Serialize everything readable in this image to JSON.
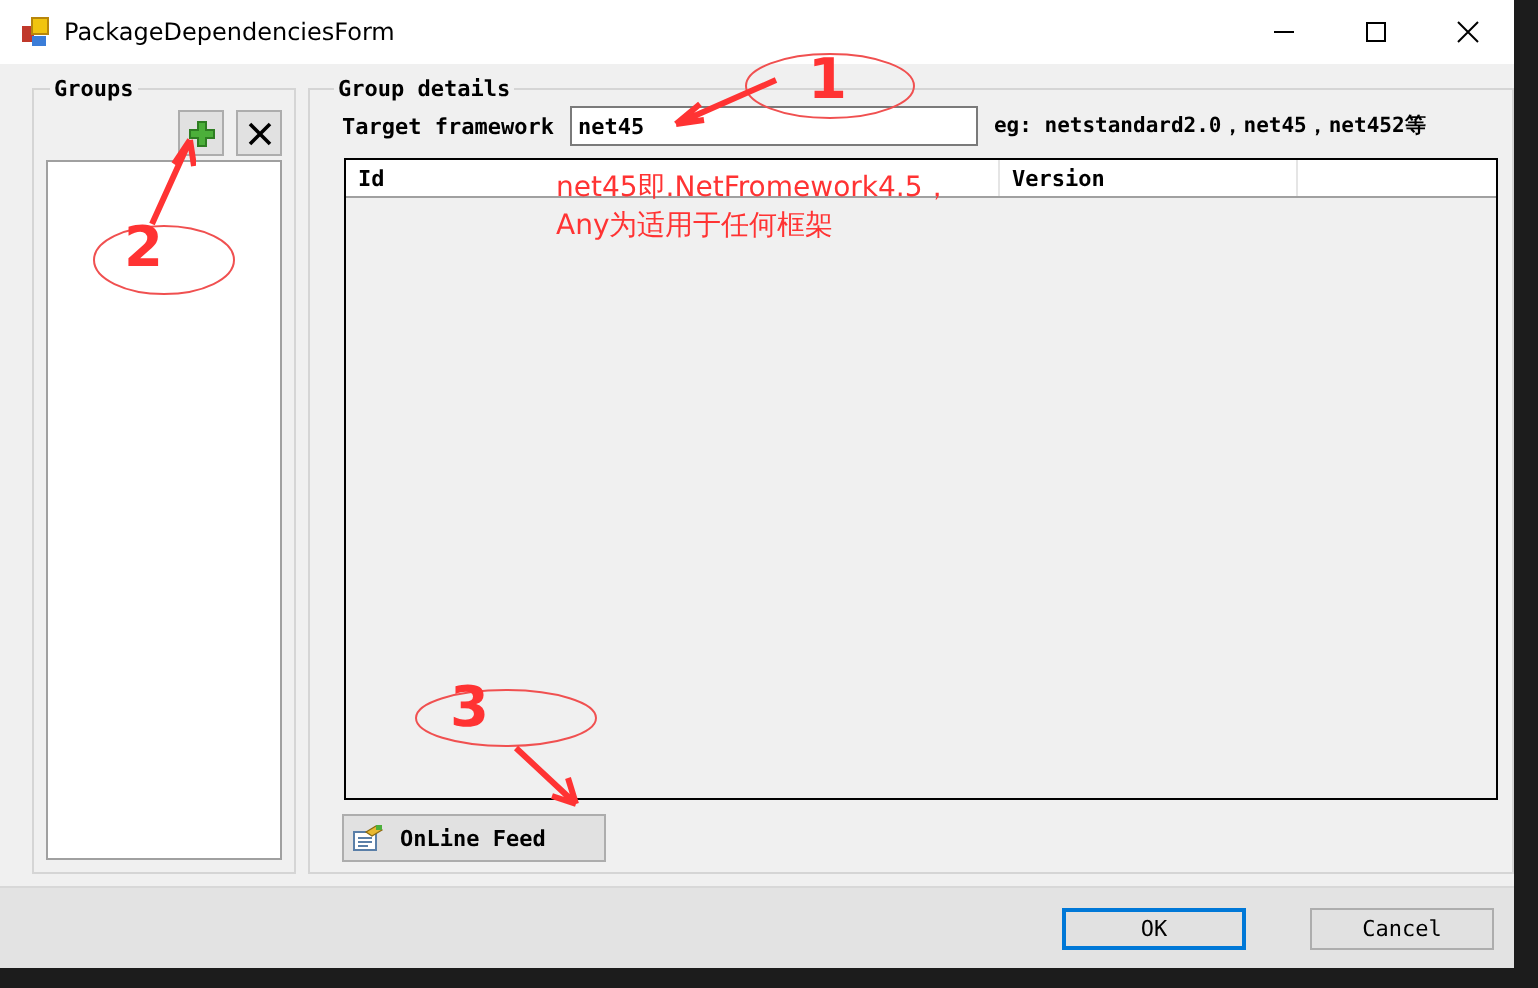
{
  "window": {
    "title": "PackageDependenciesForm"
  },
  "groups": {
    "title": "Groups"
  },
  "group_details": {
    "title": "Group details",
    "target_framework": {
      "label": "Target framework",
      "value": "net45",
      "hint": "eg: netstandard2.0，net45，net452等"
    },
    "list": {
      "columns": [
        "Id",
        "Version"
      ]
    },
    "online_feed_button": "OnLine Feed"
  },
  "buttons": [
    {
      "label": "OK",
      "selected": true
    },
    {
      "label": "Cancel",
      "selected": false
    }
  ],
  "annotations": [
    {
      "kind": "number",
      "text": "1"
    },
    {
      "kind": "number",
      "text": "2"
    },
    {
      "kind": "number",
      "text": "3"
    },
    {
      "kind": "note",
      "text": "net45即.NetFromework4.5，"
    },
    {
      "kind": "note",
      "text": "Any为适用于任何框架"
    }
  ]
}
